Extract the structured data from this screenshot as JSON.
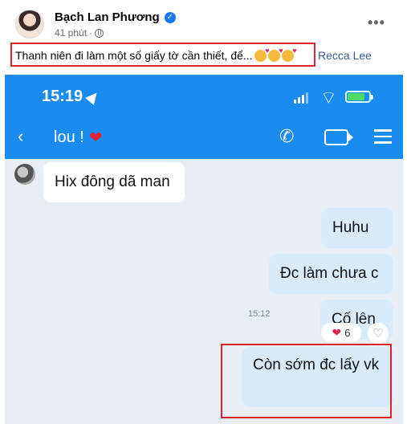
{
  "post": {
    "author": "Bạch Lan Phương",
    "time": "41 phút",
    "caption": "Thanh niên đi làm một số giấy tờ cần thiết, để...",
    "tagged": "Recca Lee",
    "more_icon": "more-horizontal-icon",
    "verified_icon": "verified-badge-icon",
    "privacy_icon": "globe-icon"
  },
  "phone": {
    "clock": "15:19",
    "chat_name": "lou !",
    "chat_heart": "❤",
    "accent": "#1a8cf0"
  },
  "messages": [
    {
      "text": "Hix đông dã man",
      "side": "in"
    },
    {
      "text": "Huhu",
      "side": "out"
    },
    {
      "text": "Đc làm chưa c",
      "side": "out"
    },
    {
      "text": "Cố lên",
      "side": "out"
    },
    {
      "text": "Còn sớm đc lấy vk",
      "side": "out",
      "time": "15:12",
      "reaction_count": "6"
    }
  ],
  "colors": {
    "highlight": "#d9252b",
    "link": "#385898",
    "bubble_out": "#d7ebfb"
  }
}
